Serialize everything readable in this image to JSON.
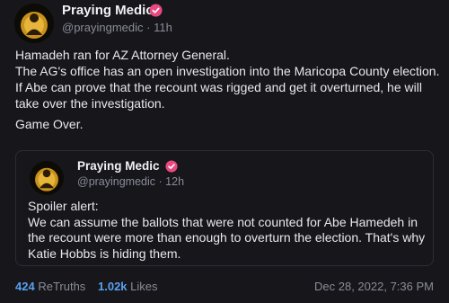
{
  "post": {
    "author": {
      "name": "Praying Medic",
      "handle": "@prayingmedic",
      "separator": "·",
      "time": "11h"
    },
    "lines": [
      "Hamadeh ran for AZ Attorney General.",
      "The AG's office has an open investigation into the Maricopa County election.",
      "If Abe can prove that the recount was rigged and get it overturned, he will",
      "take over the investigation."
    ],
    "closing": "Game Over."
  },
  "quoted": {
    "author": {
      "name": "Praying Medic",
      "handle": "@prayingmedic",
      "separator": "·",
      "time": "12h"
    },
    "lines": [
      "Spoiler alert:",
      "We can assume the ballots that were not counted for Abe Hamedeh in",
      "the recount were more than enough to overturn the election. That's why",
      "Katie Hobbs is hiding them."
    ]
  },
  "footer": {
    "retruths_count": "424",
    "retruths_label": "ReTruths",
    "likes_count": "1.02k",
    "likes_label": "Likes",
    "timestamp": "Dec 28, 2022, 7:36 PM"
  },
  "icons": {
    "verified": "verified-badge-icon",
    "avatar": "avatar"
  },
  "colors": {
    "background": "#16161b",
    "accent": "#5aa1f0",
    "verified": "#e84a7f",
    "muted": "#8a8c98"
  }
}
